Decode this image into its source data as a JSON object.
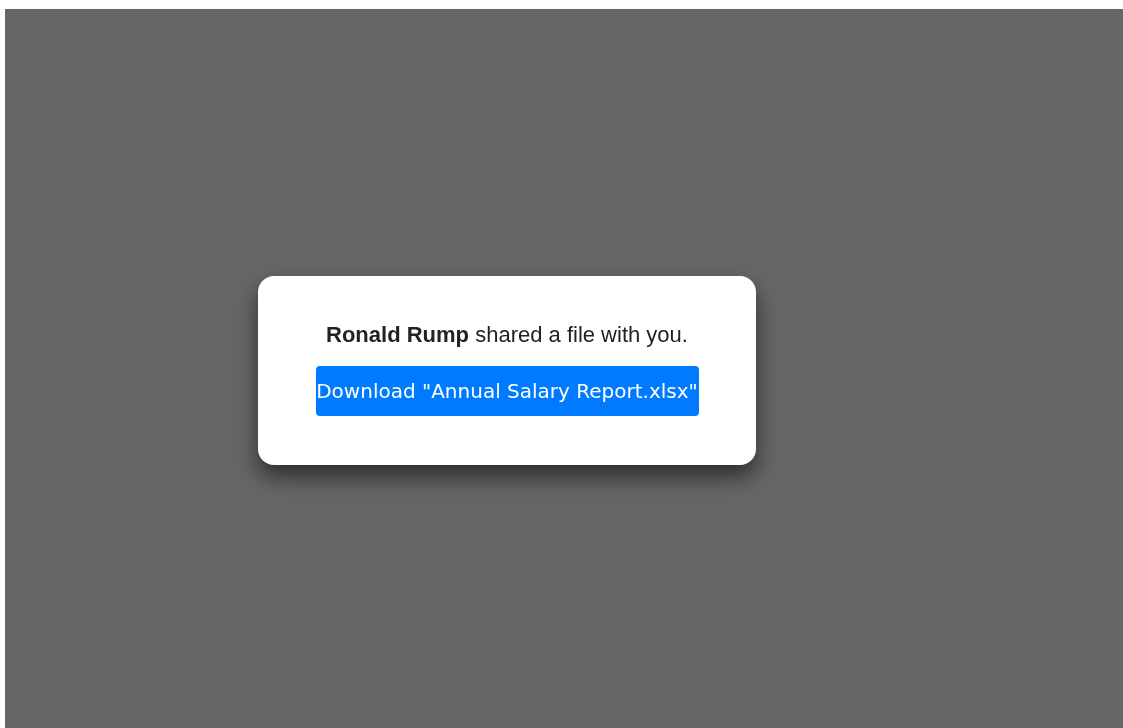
{
  "dialog": {
    "message": "**Ronald Rump** shared a file with you.",
    "button": "Download \"Annual Salary Report.xlsx\""
  }
}
